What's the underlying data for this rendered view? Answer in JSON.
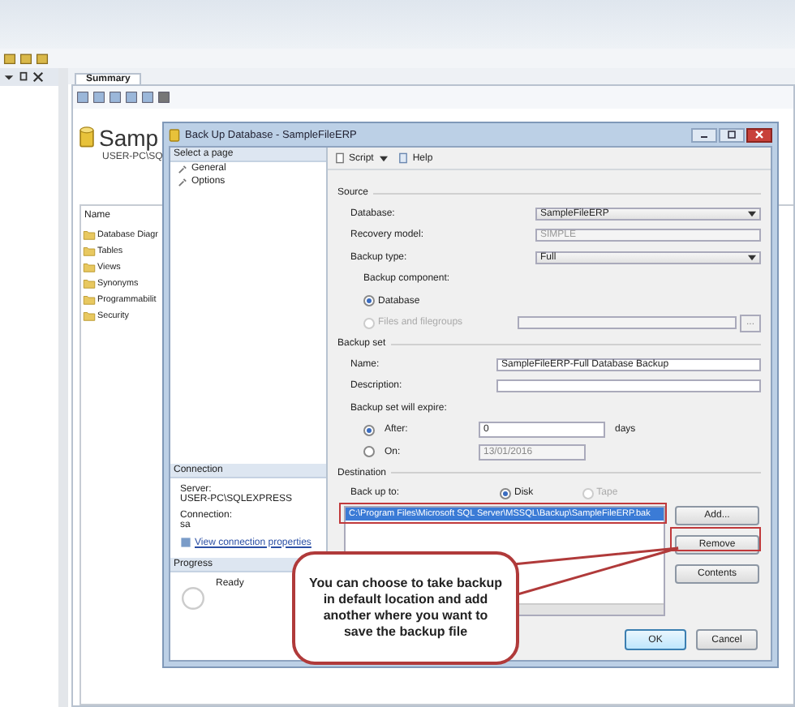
{
  "main": {
    "tab": "Summary",
    "db_title": "Samp",
    "server": "USER-PC\\SQ",
    "list_header": "Name",
    "folders": [
      "Database Diagr",
      "Tables",
      "Views",
      "Synonyms",
      "Programmabilit",
      "Security"
    ]
  },
  "dialog": {
    "title": "Back Up Database - SampleFileERP",
    "select_page": "Select a page",
    "pages": [
      "General",
      "Options"
    ],
    "connection": {
      "header": "Connection",
      "server_label": "Server:",
      "server": "USER-PC\\SQLEXPRESS",
      "connection_label": "Connection:",
      "connection": "sa",
      "link": "View connection properties"
    },
    "progress": {
      "header": "Progress",
      "status": "Ready"
    },
    "toolbar": {
      "script": "Script",
      "help": "Help"
    },
    "source": {
      "header": "Source",
      "database_label": "Database:",
      "database": "SampleFileERP",
      "recovery_label": "Recovery model:",
      "recovery": "SIMPLE",
      "type_label": "Backup type:",
      "type": "Full",
      "component_label": "Backup component:",
      "browse": "...",
      "components": [
        {
          "label": "Database",
          "checked": true,
          "disabled": false
        },
        {
          "label": "Files and filegroups",
          "checked": false,
          "disabled": true
        }
      ]
    },
    "backup_set": {
      "header": "Backup set",
      "name_label": "Name:",
      "name": "SampleFileERP-Full Database Backup",
      "description_label": "Description:",
      "expire_label": "Backup set will expire:",
      "after": {
        "label": "After:",
        "checked": true,
        "value": "0",
        "unit": "days"
      },
      "on": {
        "label": "On:",
        "checked": false,
        "value": "13/01/2016"
      }
    },
    "destination": {
      "header": "Destination",
      "backup_to_label": "Back up to:",
      "media": [
        {
          "label": "Disk",
          "checked": true,
          "disabled": false
        },
        {
          "label": "Tape",
          "checked": false,
          "disabled": true
        }
      ],
      "paths": [
        {
          "path": "C:\\Program Files\\Microsoft SQL Server\\MSSQL\\Backup\\SampleFileERP.bak",
          "selected": true
        }
      ],
      "buttons": [
        "Add...",
        "Remove",
        "Contents"
      ]
    },
    "buttons": [
      "OK",
      "Cancel"
    ]
  },
  "callout": "You can choose to take backup  in default location and add another where you want to save  the backup file"
}
